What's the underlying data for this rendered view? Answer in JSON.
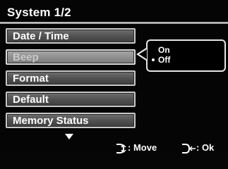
{
  "title": "System 1/2",
  "menu": {
    "items": [
      {
        "label": "Date / Time",
        "selected": false
      },
      {
        "label": "Beep",
        "selected": true
      },
      {
        "label": "Format",
        "selected": false
      },
      {
        "label": "Default",
        "selected": false
      },
      {
        "label": "Memory Status",
        "selected": false
      }
    ],
    "more_indicator": "down-arrow-icon"
  },
  "popup": {
    "options": [
      "On",
      "Off"
    ],
    "selected": "Off"
  },
  "footer": {
    "move_label": ": Move",
    "ok_label": ": Ok",
    "move_icon": "dpad-up-down-icon",
    "ok_icon": "dpad-left-enter-icon"
  }
}
